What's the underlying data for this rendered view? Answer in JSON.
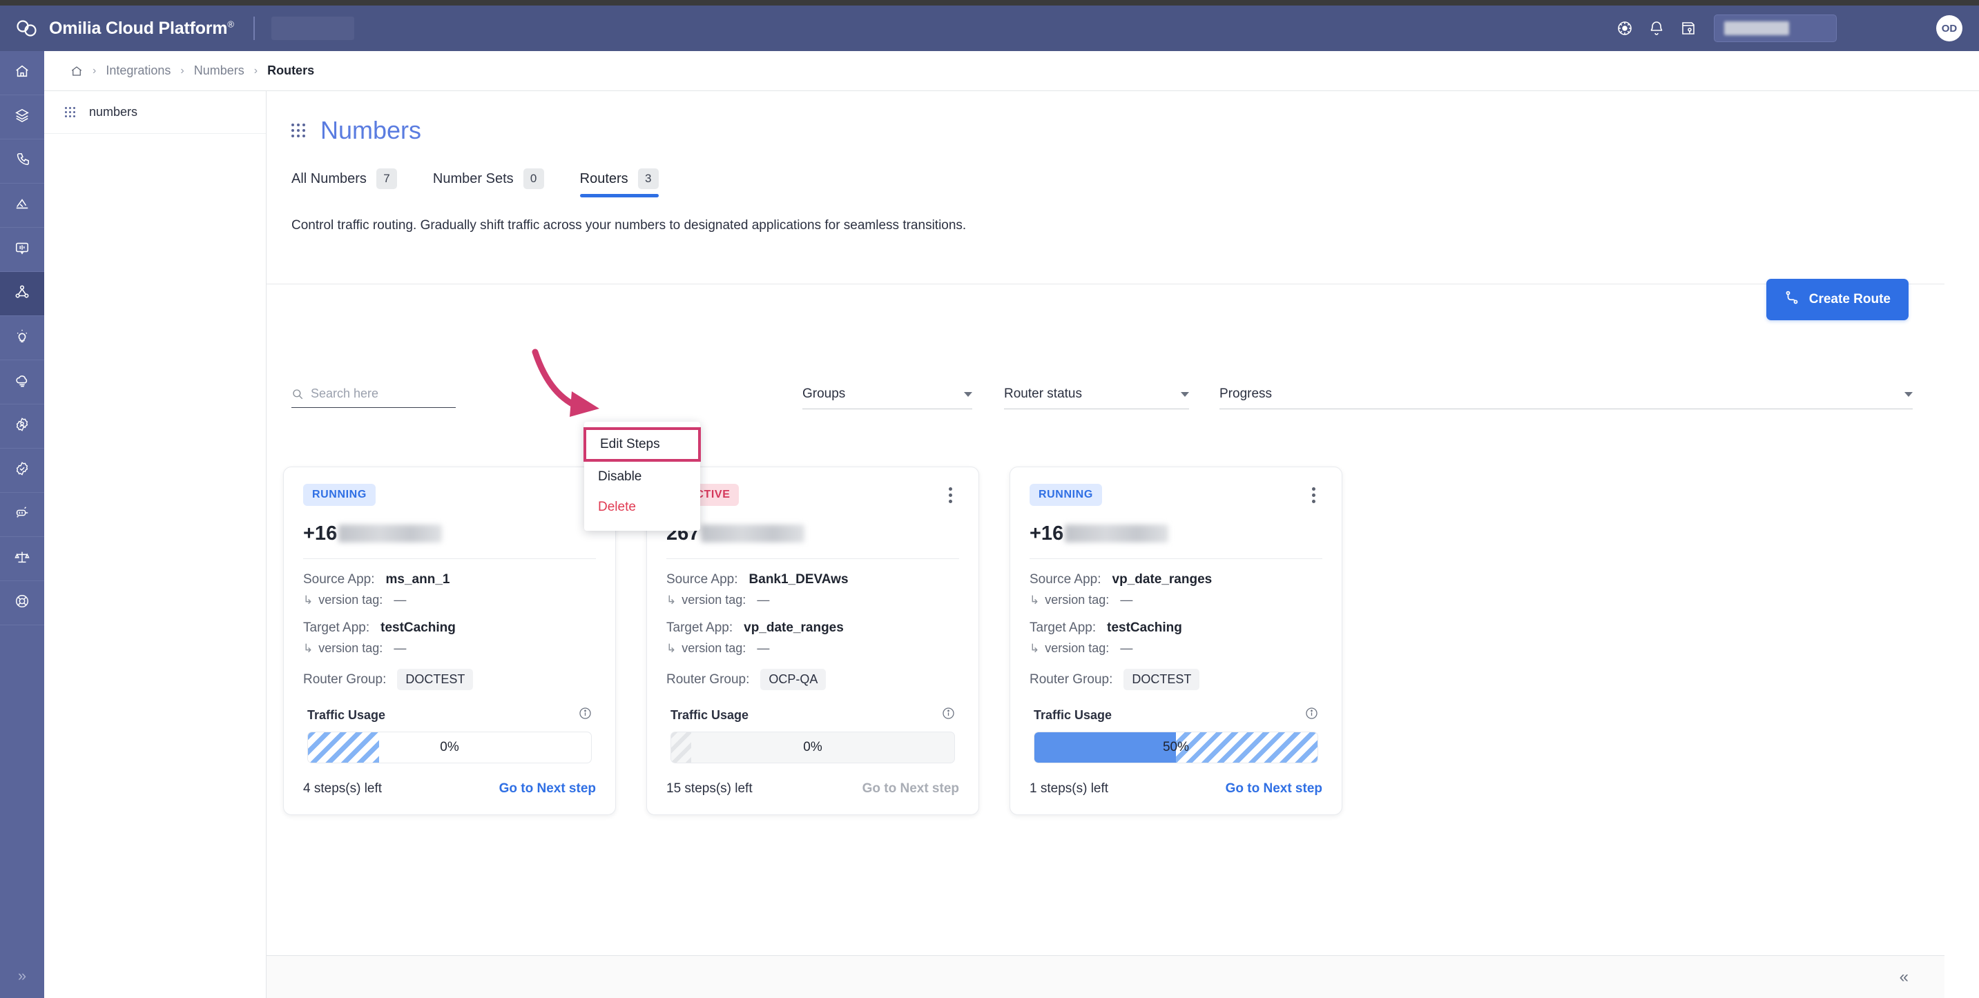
{
  "header": {
    "brand": "Omilia Cloud Platform",
    "brand_sup": "®",
    "icons": [
      "dashboard-wheel-icon",
      "bell-icon",
      "notepad-key-icon"
    ],
    "search_placeholder": "",
    "avatar_initials": "OD"
  },
  "rail": {
    "items": [
      {
        "name": "home-icon",
        "active": false
      },
      {
        "name": "layers-icon",
        "active": false
      },
      {
        "name": "phone-icon",
        "active": false
      },
      {
        "name": "analytics-icon",
        "active": false
      },
      {
        "name": "chat-icon",
        "active": false
      },
      {
        "name": "integrations-icon",
        "active": true
      },
      {
        "name": "lightbulb-icon",
        "active": false
      },
      {
        "name": "cloud-icon",
        "active": false
      },
      {
        "name": "user-settings-icon",
        "active": false
      },
      {
        "name": "verified-badge-icon",
        "active": false
      },
      {
        "name": "automation-icon",
        "active": false
      },
      {
        "name": "scales-icon",
        "active": false
      },
      {
        "name": "support-icon",
        "active": false
      }
    ],
    "collapse_glyph": "»"
  },
  "breadcrumb": {
    "home": "home-icon",
    "separator": "›",
    "items": [
      "Integrations",
      "Numbers",
      "Routers"
    ]
  },
  "subnav": {
    "items": [
      {
        "label": "numbers"
      }
    ]
  },
  "main": {
    "page_title": "Numbers",
    "tabs": [
      {
        "label": "All Numbers",
        "count": "7",
        "active": false
      },
      {
        "label": "Number Sets",
        "count": "0",
        "active": false
      },
      {
        "label": "Routers",
        "count": "3",
        "active": true
      }
    ],
    "subtitle": "Control traffic routing. Gradually shift traffic across your numbers to designated applications for seamless transitions.",
    "create_button": {
      "label": "Create Route",
      "icon": "route-icon",
      "color": "#2f6fe4"
    },
    "filters": {
      "search_placeholder": "Search here",
      "search_value": "",
      "selects": [
        {
          "label": "Groups"
        },
        {
          "label": "Router status"
        },
        {
          "label": "Progress"
        }
      ]
    },
    "labels": {
      "source_app": "Source App:",
      "target_app": "Target App:",
      "version_tag": "version tag:",
      "router_group": "Router Group:",
      "traffic_usage": "Traffic Usage",
      "next_step": "Go to Next step"
    },
    "cards": [
      {
        "status": "RUNNING",
        "status_type": "running",
        "phone_prefix": "+16",
        "source_app": "ms_ann_1",
        "source_version_tag": "—",
        "target_app": "testCaching",
        "target_version_tag": "—",
        "router_group": "DOCTEST",
        "traffic_percent": "0%",
        "traffic_fill": 0,
        "traffic_stripe": 25,
        "stripe_color": "blue",
        "bar_background": "white",
        "steps_left": "4 steps(s) left",
        "next_step_enabled": true
      },
      {
        "status": "INACTIVE",
        "status_type": "inactive",
        "phone_prefix": "267",
        "source_app": "Bank1_DEVAws",
        "source_version_tag": "—",
        "target_app": "vp_date_ranges",
        "target_version_tag": "—",
        "router_group": "OCP-QA",
        "traffic_percent": "0%",
        "traffic_fill": 0,
        "traffic_stripe": 7,
        "stripe_color": "gray",
        "bar_background": "gray",
        "steps_left": "15 steps(s) left",
        "next_step_enabled": false
      },
      {
        "status": "RUNNING",
        "status_type": "running",
        "phone_prefix": "+16",
        "source_app": "vp_date_ranges",
        "source_version_tag": "—",
        "target_app": "testCaching",
        "target_version_tag": "—",
        "router_group": "DOCTEST",
        "traffic_percent": "50%",
        "traffic_fill": 50,
        "traffic_stripe": 100,
        "stripe_color": "blue",
        "bar_background": "white",
        "steps_left": "1 steps(s) left",
        "next_step_enabled": true
      }
    ]
  },
  "context_menu": {
    "items": [
      {
        "label": "Edit Steps",
        "danger": false,
        "highlighted": true
      },
      {
        "label": "Disable",
        "danger": false,
        "highlighted": false
      },
      {
        "label": "Delete",
        "danger": true,
        "highlighted": false
      }
    ],
    "highlight_color": "#cf3a6e"
  },
  "annotation": {
    "arrow_color": "#cf3a6e"
  },
  "footer": {
    "collapse_glyph": "«"
  }
}
